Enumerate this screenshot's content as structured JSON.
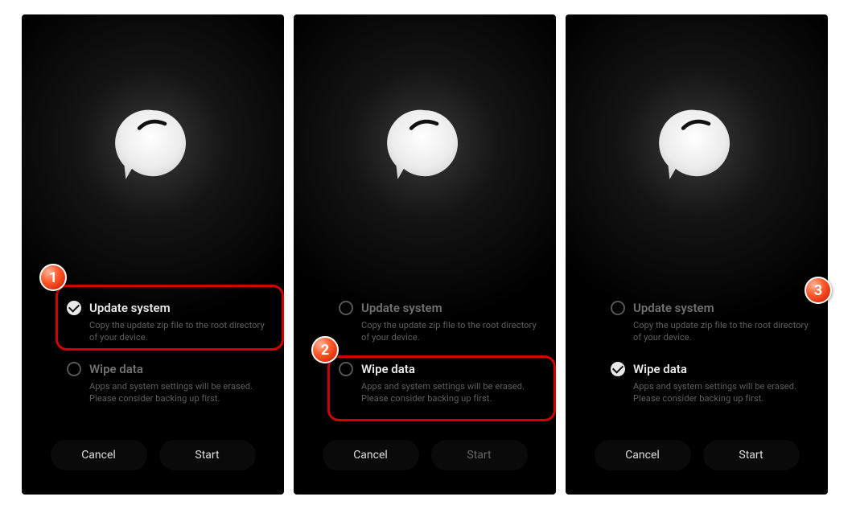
{
  "option_update": {
    "title": "Update system",
    "desc": "Copy the update zip file to the root directory of your device."
  },
  "option_wipe": {
    "title": "Wipe data",
    "desc": "Apps and system settings will be erased. Please consider backing up first."
  },
  "buttons": {
    "cancel": "Cancel",
    "start": "Start"
  },
  "badges": {
    "b1": "1",
    "b2": "2",
    "b3": "3"
  }
}
